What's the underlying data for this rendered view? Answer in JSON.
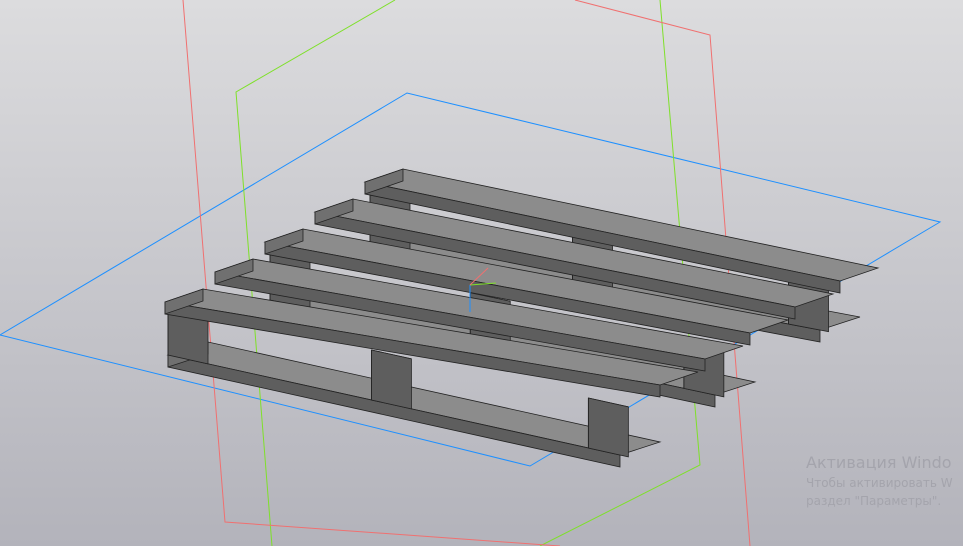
{
  "viewport": {
    "model": "pallet",
    "colors": {
      "background_top": "#dcdcde",
      "background_bottom": "#b3b3bb",
      "plane_xy": "#1e90ff",
      "plane_yz": "#7fe02a",
      "plane_xz": "#f07070",
      "board_top": "#8c8c8c",
      "board_side": "#5e5e5e"
    }
  },
  "watermark": {
    "line1": "Активация Windo",
    "line2": "Чтобы активировать W",
    "line3": "раздел \"Параметры\"."
  }
}
